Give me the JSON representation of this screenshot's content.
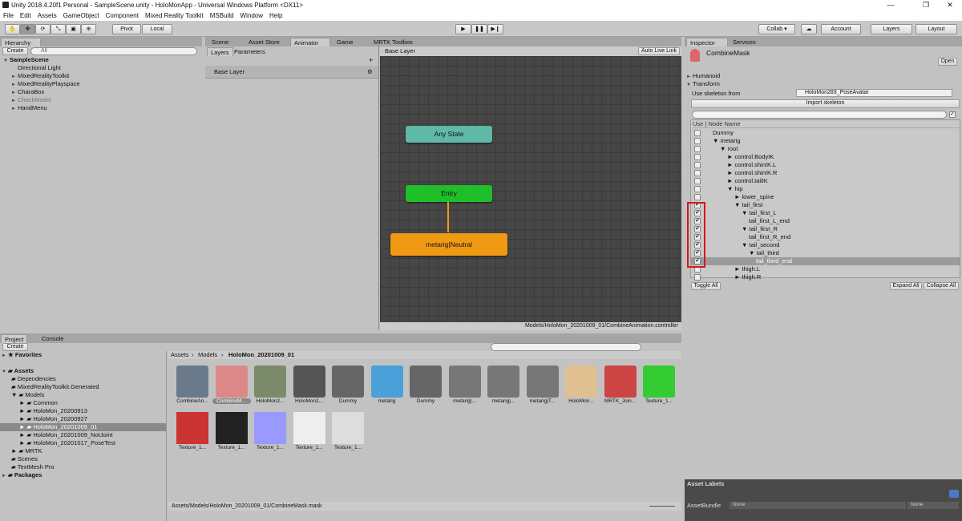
{
  "window": {
    "title": "Unity 2018.4.20f1 Personal - SampleScene.unity - HoloMonApp - Universal Windows Platform <DX11>",
    "minimize": "—",
    "maximize": "❐",
    "close": "✕"
  },
  "menu": [
    "File",
    "Edit",
    "Assets",
    "GameObject",
    "Component",
    "Mixed Reality Toolkit",
    "MSBuild",
    "Window",
    "Help"
  ],
  "toolbar": {
    "pivot": "Pivot",
    "local": "Local",
    "collab": "Collab ▾",
    "account": "Account",
    "layers": "Layers",
    "layout": "Layout"
  },
  "hierarchy": {
    "tab": "Hierarchy",
    "create": "Create",
    "search_placeholder": "All",
    "scene": "SampleScene",
    "items": [
      "Directional Light",
      "MixedRealityToolkit",
      "MixedRealityPlayspace",
      "CharaBox",
      "CheckModel",
      "HandMenu"
    ]
  },
  "center_tabs": [
    "Scene",
    "Asset Store",
    "Animator",
    "Game",
    "MRTK Toolbox"
  ],
  "animator": {
    "layers_tab": "Layers",
    "parameters_tab": "Parameters",
    "layer_name": "Base Layer",
    "breadcrumb": "Base Layer",
    "auto_live": "Auto Live Link",
    "nodes": {
      "any_state": "Any State",
      "entry": "Entry",
      "neutral": "metarig|Neutral"
    },
    "status_path": "Models/HoloMon_20201009_01/CombineAnimation.controller"
  },
  "inspector": {
    "tab": "Inspector",
    "services_tab": "Services",
    "asset_name": "CombineMask",
    "open": "Open",
    "humanoid": "Humanoid",
    "transform": "Transform",
    "skeleton_label": "Use skeleton from",
    "skeleton_value": "HoloMon283_PoseAvatar",
    "import": "Import skeleton",
    "col_use": "Use",
    "col_name": "Node Name",
    "nodes": [
      {
        "name": "Dummy",
        "checked": false,
        "arrow": ""
      },
      {
        "name": "metarig",
        "checked": false,
        "arrow": "▼"
      },
      {
        "name": "root",
        "checked": false,
        "arrow": "▼"
      },
      {
        "name": "control.BodyIK",
        "checked": false,
        "arrow": "►"
      },
      {
        "name": "control.shinIK.L",
        "checked": false,
        "arrow": "►"
      },
      {
        "name": "control.shinIK.R",
        "checked": false,
        "arrow": "►"
      },
      {
        "name": "control.tailIK",
        "checked": false,
        "arrow": "►"
      },
      {
        "name": "hip",
        "checked": false,
        "arrow": "▼"
      },
      {
        "name": "lower_spine",
        "checked": false,
        "arrow": "►"
      },
      {
        "name": "tail_first",
        "checked": true,
        "arrow": "▼"
      },
      {
        "name": "tail_first_L",
        "checked": true,
        "arrow": "▼"
      },
      {
        "name": "tail_first_L_end",
        "checked": true,
        "arrow": ""
      },
      {
        "name": "tail_first_R",
        "checked": true,
        "arrow": "▼"
      },
      {
        "name": "tail_first_R_end",
        "checked": true,
        "arrow": ""
      },
      {
        "name": "tail_second",
        "checked": true,
        "arrow": "▼"
      },
      {
        "name": "tail_third",
        "checked": true,
        "arrow": "▼"
      },
      {
        "name": "tail_third_end",
        "checked": true,
        "arrow": ""
      },
      {
        "name": "thigh.L",
        "checked": false,
        "arrow": "►"
      },
      {
        "name": "thigh.R",
        "checked": false,
        "arrow": "►"
      }
    ],
    "toggle_all": "Toggle All",
    "expand_all": "Expand All",
    "collapse_all": "Collapse All",
    "asset_labels": "Asset Labels",
    "bundle_label": "AssetBundle",
    "bundle_value": "None",
    "variant_value": "None"
  },
  "project": {
    "tab": "Project",
    "console_tab": "Console",
    "create": "Create",
    "favorites": "Favorites",
    "assets": "Assets",
    "folders": [
      "Dependencies",
      "MixedRealityToolkit.Generated",
      "Models",
      "Common",
      "HoloMon_20200913",
      "HoloMon_20200927",
      "HoloMon_20201009_01",
      "HoloMon_20201009_NotJoint",
      "HoloMon_20201017_PoseTest",
      "MRTK",
      "Scenes",
      "TextMesh Pro"
    ],
    "packages": "Packages",
    "breadcrumb": [
      "Assets",
      "Models",
      "HoloMon_20201009_01"
    ],
    "row1": [
      "CombineAn...",
      "CombineM...",
      "HoloMon2...",
      "HoloMon2...",
      "Dummy",
      "metarig",
      "Dummy",
      "metarig|...",
      "metarig|...",
      "metarig|T...",
      "HoloMon...",
      "MRTK_Join...",
      "Texture_1..."
    ],
    "row2": [
      "Texture_1...",
      "Texture_1...",
      "Texture_1...",
      "Texture_1...",
      "Texture_1..."
    ],
    "status": "Assets/Models/HoloMon_20201009_01/CombineMask.mask"
  },
  "colors": {
    "any_state": "#5fb8a8",
    "entry": "#1fbf2a",
    "neutral": "#f09a14",
    "highlight": "#d9151b"
  }
}
